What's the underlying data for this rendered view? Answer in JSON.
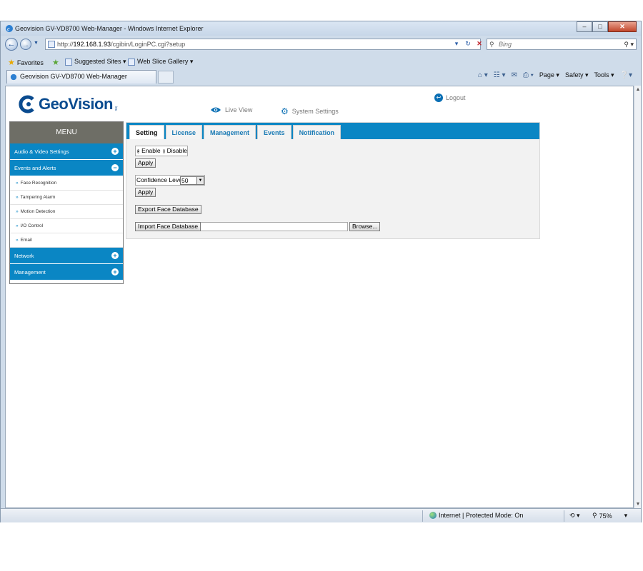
{
  "browser": {
    "window_title": "Geovision GV-VD8700 Web-Manager - Windows Internet Explorer",
    "address_prefix": "http://",
    "address_host": "192.168.1.93",
    "address_path": "/cgibin/LoginPC.cgi?setup",
    "search_placeholder": "Bing",
    "favorites_label": "Favorites",
    "suggested_sites_label": "Suggested Sites ▾",
    "web_slice_label": "Web Slice Gallery ▾",
    "tab_title": "Geovision GV-VD8700 Web-Manager",
    "cmd_page": "Page ▾",
    "cmd_safety": "Safety ▾",
    "cmd_tools": "Tools ▾",
    "status_zone": "Internet | Protected Mode: On",
    "zoom": "75%"
  },
  "page": {
    "logo_text": "GeoVision",
    "logo_inc": "inc",
    "live_view": "Live View",
    "system_settings": "System Settings",
    "logout": "Logout",
    "menu": {
      "header": "MENU",
      "sections": [
        {
          "label": "Audio & Video Settings",
          "toggle": "+"
        },
        {
          "label": "Events and Alerts",
          "toggle": "−"
        },
        {
          "label": "Network",
          "toggle": "+"
        },
        {
          "label": "Management",
          "toggle": "+"
        }
      ],
      "sub_items": [
        "Face Recognition",
        "Tampering Alarm",
        "Motion Detection",
        "I/O Control",
        "Email"
      ]
    },
    "tabs": [
      "Setting",
      "License",
      "Management",
      "Events",
      "Notification"
    ],
    "form": {
      "enable_label": "Enable",
      "disable_label": "Disable",
      "apply_label": "Apply",
      "confidence_label": "Confidence Leve",
      "confidence_value": "50",
      "export_label": "Export Face Database",
      "import_label": "Import Face Database",
      "browse_label": "Browse..."
    }
  }
}
